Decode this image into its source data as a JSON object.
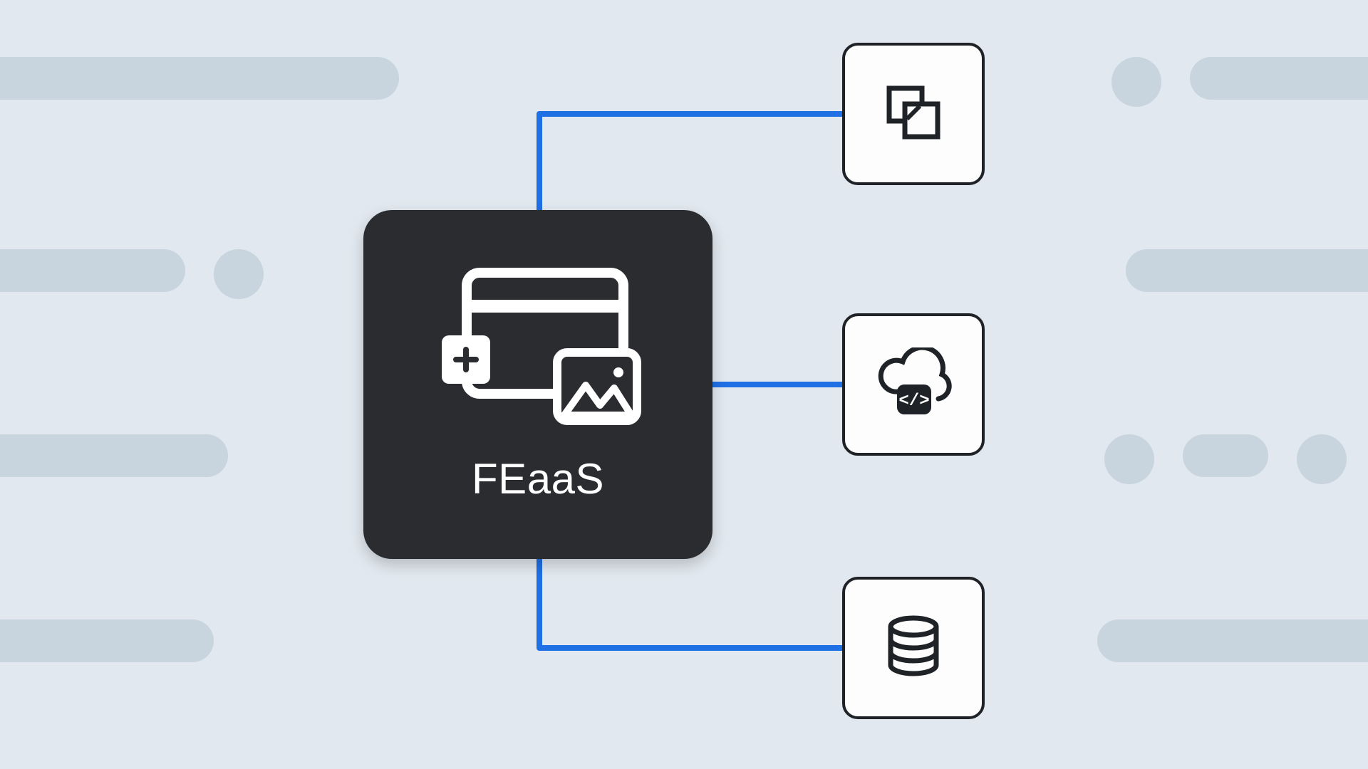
{
  "diagram": {
    "main": {
      "label": "FEaaS",
      "icon": "component-builder-icon"
    },
    "services": [
      {
        "icon": "overlap-squares-icon",
        "name": "integration-service"
      },
      {
        "icon": "cloud-code-icon",
        "name": "cloud-code-service"
      },
      {
        "icon": "database-icon",
        "name": "database-service"
      }
    ],
    "colors": {
      "background": "#e1e8ef",
      "background_shapes": "#c8d4de",
      "connector": "#1f6fe5",
      "node_dark": "#2a2c30",
      "node_light": "#fdfdfd",
      "node_border": "#1f2227"
    }
  }
}
